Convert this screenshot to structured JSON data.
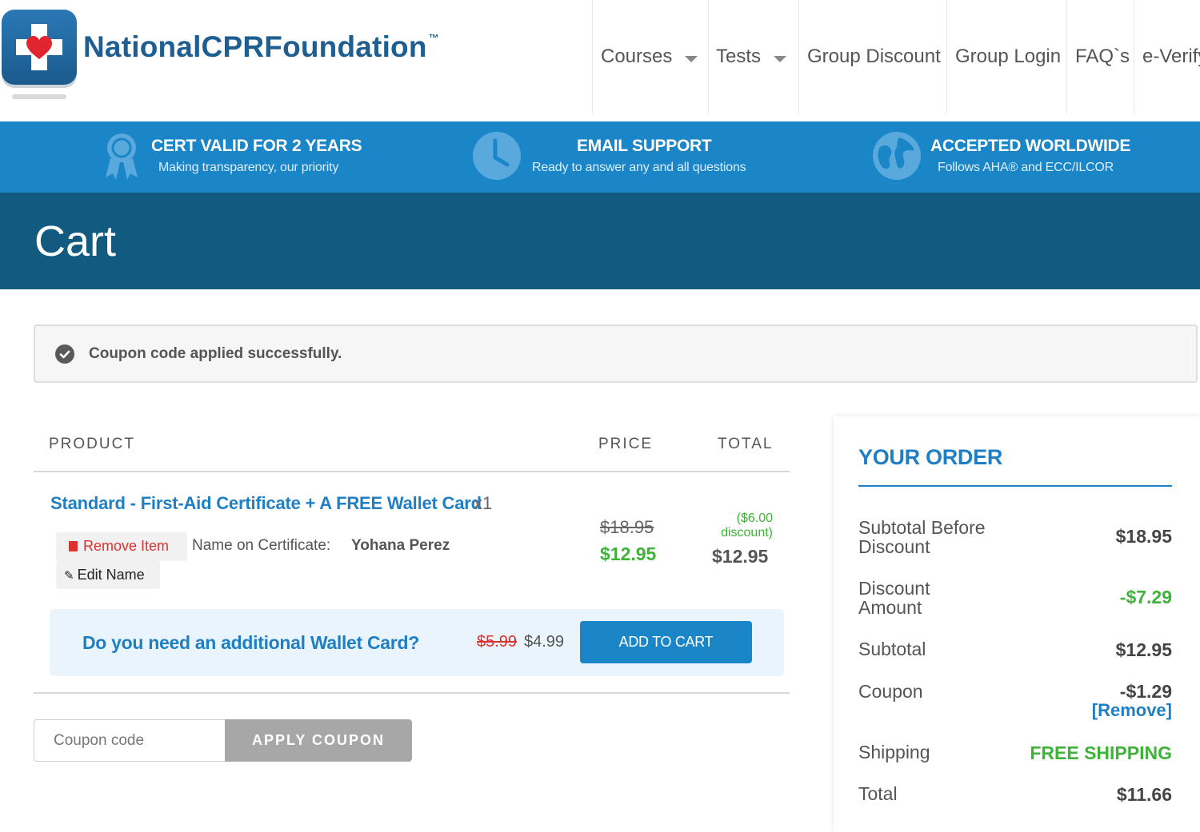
{
  "header": {
    "brand": "NationalCPRFoundation",
    "brand_tm": "™",
    "nav": [
      {
        "label": "Courses",
        "has_dropdown": true
      },
      {
        "label": "Tests",
        "has_dropdown": true
      },
      {
        "label": "Group Discount",
        "has_dropdown": false
      },
      {
        "label": "Group Login",
        "has_dropdown": false
      },
      {
        "label": "FAQ`s",
        "has_dropdown": false
      },
      {
        "label": "e-Verify",
        "has_dropdown": false
      }
    ]
  },
  "features": [
    {
      "icon": "ribbon-award-icon",
      "title": "CERT VALID FOR 2 YEARS",
      "subtitle": "Making transparency, our priority"
    },
    {
      "icon": "clock-icon",
      "title": "EMAIL SUPPORT",
      "subtitle": "Ready to answer any and all questions"
    },
    {
      "icon": "globe-icon",
      "title": "ACCEPTED WORLDWIDE",
      "subtitle": "Follows AHA® and ECC/ILCOR"
    }
  ],
  "page": {
    "title": "Cart"
  },
  "notice": {
    "icon": "check-circle-icon",
    "message": "Coupon code applied successfully."
  },
  "cart": {
    "columns": {
      "product": "PRODUCT",
      "price": "PRICE",
      "total": "TOTAL"
    },
    "item": {
      "name": "Standard - First-Aid Certificate + A FREE Wallet Card",
      "quantity": "x1",
      "remove_label": "Remove Item",
      "edit_label": "Edit Name",
      "cert_label": "Name on Certificate:",
      "cert_name": "Yohana Perez",
      "price_original": "$18.95",
      "price_sale": "$12.95",
      "discount_note": "($6.00 discount)",
      "total": "$12.95"
    },
    "upsell": {
      "question": "Do you need an additional Wallet Card?",
      "price_original": "$5.99",
      "price_sale": "$4.99",
      "button": "ADD TO CART"
    },
    "coupon": {
      "placeholder": "Coupon code",
      "value": "",
      "button": "APPLY COUPON"
    }
  },
  "order": {
    "title": "YOUR ORDER",
    "rows": {
      "subtotal_before": {
        "label": "Subtotal Before Discount",
        "value": "$18.95"
      },
      "discount": {
        "label": "Discount Amount",
        "value": "-$7.29"
      },
      "subtotal": {
        "label": "Subtotal",
        "value": "$12.95"
      },
      "coupon": {
        "label": "Coupon",
        "value": "-$1.29",
        "remove": "[Remove]"
      },
      "shipping": {
        "label": "Shipping",
        "value": "FREE SHIPPING"
      },
      "total": {
        "label": "Total",
        "value": "$11.66"
      }
    }
  },
  "colors": {
    "brand_blue": "#1e5e90",
    "band_blue": "#1a86c8",
    "title_bar": "#135a80",
    "link_blue": "#1f7fc4",
    "sale_green": "#3fb338",
    "remove_red": "#d9322f",
    "heart_red": "#e0252f"
  }
}
